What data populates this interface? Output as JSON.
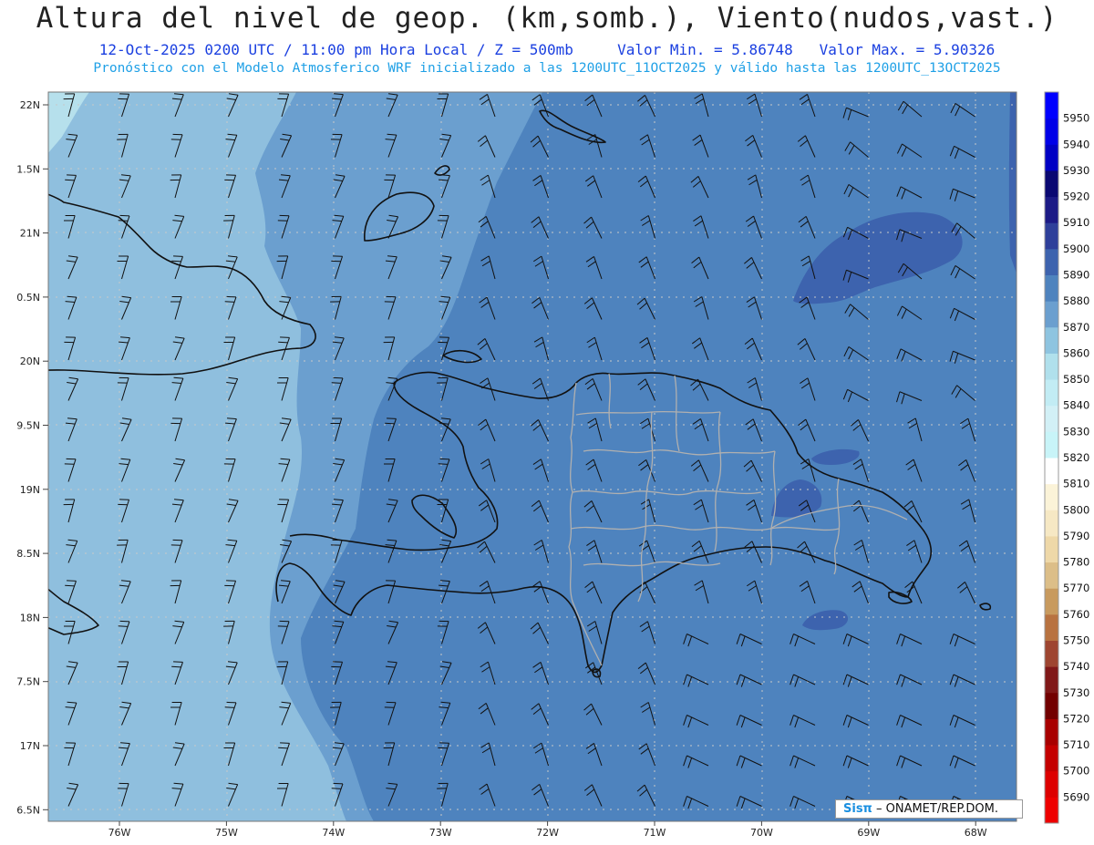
{
  "header": {
    "title": "Altura del nivel de geop. (km,somb.), Viento(nudos,vast.)",
    "subtitle_time": "12-Oct-2025  0200 UTC / 11:00 pm Hora Local / Z = 500mb",
    "value_min": "Valor Min. = 5.86748",
    "value_max": "Valor Max. = 5.90326",
    "model_info": "Pronóstico con el Modelo Atmosferico WRF inicializado a las 1200UTC_11OCT2025 y válido hasta las  1200UTC_13OCT2025"
  },
  "map": {
    "lat_labels": [
      "22N",
      "1.5N",
      "21N",
      "0.5N",
      "20N",
      "9.5N",
      "19N",
      "8.5N",
      "18N",
      "7.5N",
      "17N",
      "6.5N"
    ],
    "lon_labels": [
      "76W",
      "75W",
      "74W",
      "73W",
      "72W",
      "71W",
      "70W",
      "69W",
      "68W"
    ],
    "colors": {
      "ocean_base": "#4e83be",
      "band_5880": "#6b9fcf",
      "band_5870": "#8fbfde",
      "band_5860": "#b6e0ec",
      "band_5900": "#3d63ae",
      "coastline": "#111111",
      "province_border": "#b0b0b0",
      "grid": "#c8c8c8",
      "wind_barb": "#111111"
    }
  },
  "colorbar": {
    "levels": [
      "5690",
      "5700",
      "5710",
      "5720",
      "5730",
      "5740",
      "5750",
      "5760",
      "5770",
      "5780",
      "5790",
      "5800",
      "5810",
      "5820",
      "5830",
      "5840",
      "5850",
      "5860",
      "5870",
      "5880",
      "5890",
      "5900",
      "5910",
      "5920",
      "5930",
      "5940",
      "5950"
    ],
    "colors": [
      "#ee0000",
      "#dd0000",
      "#c40000",
      "#a80000",
      "#720000",
      "#801818",
      "#9e4530",
      "#b87240",
      "#c89a5e",
      "#dcbe88",
      "#eed8a8",
      "#f6e8c4",
      "#fbf3d8",
      "#ffffff",
      "#c8f4f8",
      "#d2f0f6",
      "#c2ecf4",
      "#b0e0ec",
      "#8ec4e0",
      "#6b9fcf",
      "#4e83be",
      "#3d63ae",
      "#2e3f9a",
      "#1c1a86",
      "#0a0872",
      "#0000c4",
      "#0000e8",
      "#0000ff"
    ]
  },
  "credit": {
    "brand": "Sisπ",
    "text": "– ONAMET/REP.DOM."
  }
}
